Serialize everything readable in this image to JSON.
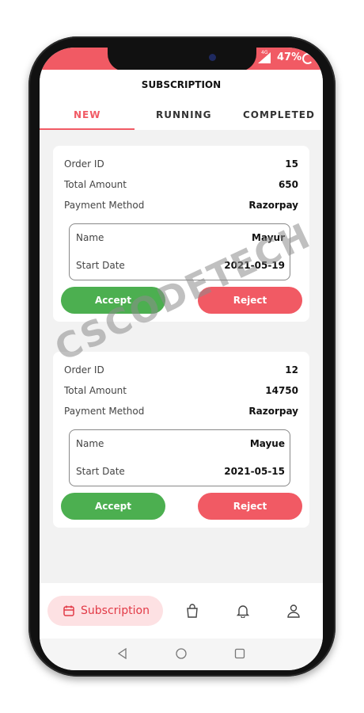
{
  "status_bar": {
    "network": "4G",
    "battery": "47%"
  },
  "app_bar": {
    "title": "SUBSCRIPTION"
  },
  "tabs": [
    {
      "label": "NEW",
      "active": true
    },
    {
      "label": "RUNNING",
      "active": false
    },
    {
      "label": "COMPLETED",
      "active": false
    }
  ],
  "orders": [
    {
      "order_id_label": "Order ID",
      "order_id": "15",
      "total_amount_label": "Total Amount",
      "total_amount": "650",
      "payment_method_label": "Payment Method",
      "payment_method": "Razorpay",
      "name_label": "Name",
      "name": "Mayur",
      "start_date_label": "Start Date",
      "start_date": "2021-05-19",
      "accept_label": "Accept",
      "reject_label": "Reject"
    },
    {
      "order_id_label": "Order ID",
      "order_id": "12",
      "total_amount_label": "Total Amount",
      "total_amount": "14750",
      "payment_method_label": "Payment Method",
      "payment_method": "Razorpay",
      "name_label": "Name",
      "name": "Mayue",
      "start_date_label": "Start Date",
      "start_date": "2021-05-15",
      "accept_label": "Accept",
      "reject_label": "Reject"
    }
  ],
  "bottom_nav": {
    "subscription_label": "Subscription",
    "items": [
      "calendar-icon",
      "bag-icon",
      "bell-icon",
      "user-icon"
    ]
  },
  "watermark": "CSCODETECH",
  "colors": {
    "accent": "#f15a64",
    "accept": "#4caf50",
    "active_nav_bg": "#fde1e3"
  }
}
